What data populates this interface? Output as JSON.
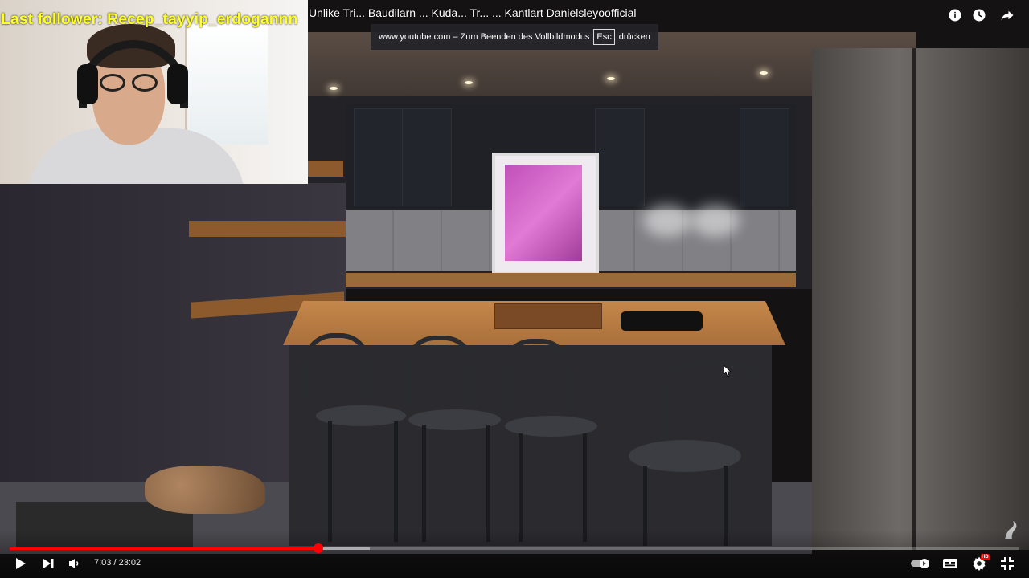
{
  "overlay": {
    "follower_text": "Last follower: Recep_tayyip_erdogannn"
  },
  "video": {
    "title": "Unlike Tri... Baudilarn ... Kuda... Tr... ... Kantlart Danielsleyoofficial"
  },
  "fullscreen_toast": {
    "prefix": "www.youtube.com – Zum Beenden des Vollbildmodus",
    "key": "Esc",
    "suffix": "drücken"
  },
  "top_bar": {
    "icons": [
      "info-icon",
      "watch-later-icon",
      "share-icon"
    ]
  },
  "player": {
    "current_time": "7:03",
    "separator": " / ",
    "duration": "23:02",
    "time_display": "7:03 / 23:02",
    "progress_played": 0.306,
    "progress_buffered": 0.357,
    "autoplay": true,
    "subtitles_enabled": false,
    "quality_badge": "HD"
  },
  "colors": {
    "progress_red": "#ff0000",
    "follower_yellow": "#ffff2b"
  }
}
